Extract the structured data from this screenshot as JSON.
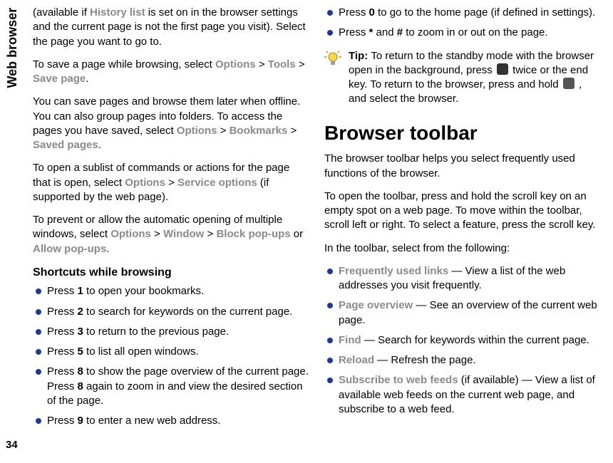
{
  "side": {
    "label": "Web browser",
    "page_number": "34"
  },
  "col1": {
    "p1a": "(available if ",
    "p1b": "History list",
    "p1c": " is set on in the browser settings and the current page is not the first page you visit). Select the page you want to go to.",
    "p2a": "To save a page while browsing, select ",
    "p2b": "Options",
    "gt": " > ",
    "p2c": "Tools",
    "p2d": "Save page",
    "p2e": ".",
    "p3a": "You can save pages and browse them later when offline. You can also group pages into folders. To access the pages you have saved, select ",
    "p3b": "Options",
    "p3c": "Bookmarks",
    "p3d": "Saved pages",
    "p4a": "To open a sublist of commands or actions for the page that is open, select ",
    "p4b": "Options",
    "p4c": "Service options",
    "p4d": " (if supported by the web page).",
    "p5a": "To prevent or allow the automatic opening of multiple windows, select ",
    "p5b": "Options",
    "p5c": "Window",
    "p5d": "Block pop-ups",
    "p5e": " or ",
    "p5f": "Allow pop-ups",
    "subhead1": "Shortcuts while browsing",
    "s1a": "Press ",
    "s1b": "1",
    "s1c": " to open your bookmarks.",
    "s2a": "Press ",
    "s2b": "2",
    "s2c": " to search for keywords on the current page.",
    "s3a": "Press ",
    "s3b": "3",
    "s3c": " to return to the previous page.",
    "s4a": "Press ",
    "s4b": "5",
    "s4c": " to list all open windows.",
    "s5a": "Press ",
    "s5b": "8",
    "s5c": " to show the page overview of the current page. Press ",
    "s5d": "8",
    "s5e": " again to zoom in and view the desired section of the page.",
    "s6a": "Press ",
    "s6b": "9",
    "s6c": " to enter a new web address."
  },
  "col2": {
    "s7a": "Press ",
    "s7b": "0",
    "s7c": " to go to the home page (if defined in settings).",
    "s8a": "Press ",
    "s8b": "*",
    "s8c": " and ",
    "s8d": "#",
    "s8e": " to zoom in or out on the page.",
    "tipLabel": "Tip: ",
    "tip1": "To return to the standby mode with the browser open in the background, press ",
    "tip2": " twice or the end key. To return to the browser, press and hold ",
    "tip3": " , and select the browser.",
    "h2": "Browser toolbar",
    "p6": "The browser toolbar helps you select frequently used functions of the browser.",
    "p7": "To open the toolbar, press and hold the scroll key on an empty spot on a web page. To move within the toolbar, scroll left or right. To select a feature, press the scroll key.",
    "p8": "In the toolbar, select from the following:",
    "t1a": "Frequently used links",
    "t1b": "  — View a list of the web addresses you visit frequently.",
    "t2a": "Page overview",
    "t2b": "  — See an overview of the current web page.",
    "t3a": "Find",
    "t3b": " — Search for keywords within the current page.",
    "t4a": "Reload",
    "t4b": " — Refresh the page.",
    "t5a": "Subscribe to web feeds",
    "t5b": " (if available) — View a list of available web feeds on the current web page, and subscribe to a web feed."
  }
}
